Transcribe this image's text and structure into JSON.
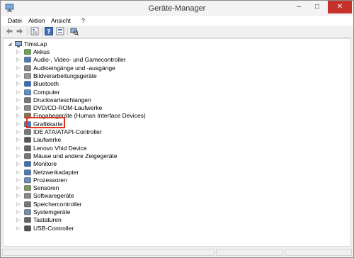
{
  "window": {
    "title": "Geräte-Manager",
    "buttons": {
      "minimize": "–",
      "maximize": "□",
      "close": "✕"
    }
  },
  "menu": [
    "Datei",
    "Aktion",
    "Ansicht",
    "?"
  ],
  "toolbar": [
    "back-arrow-icon",
    "forward-arrow-icon",
    "properties-icon",
    "help-icon",
    "details-icon",
    "scan-hardware-icon"
  ],
  "tree": {
    "root": "TimsLap",
    "items": [
      "Akkus",
      "Audio-, Video- und Gamecontroller",
      "Audioeingänge und -ausgänge",
      "Bildverarbeitungsgeräte",
      "Bluetooth",
      "Computer",
      "Druckwarteschlangen",
      "DVD/CD-ROM-Laufwerke",
      "Eingabegeräte (Human Interface Devices)",
      "Grafikkarte",
      "IDE ATA/ATAPI-Controller",
      "Laufwerke",
      "Lenovo Vhid Device",
      "Mäuse und andere Zeigegeräte",
      "Monitore",
      "Netzwerkadapter",
      "Prozessoren",
      "Sensoren",
      "Softwaregeräte",
      "Speichercontroller",
      "Systemgeräte",
      "Tastaturen",
      "USB-Controller"
    ]
  },
  "colors": {
    "highlight": "#e03420",
    "close_button": "#c7312b"
  }
}
